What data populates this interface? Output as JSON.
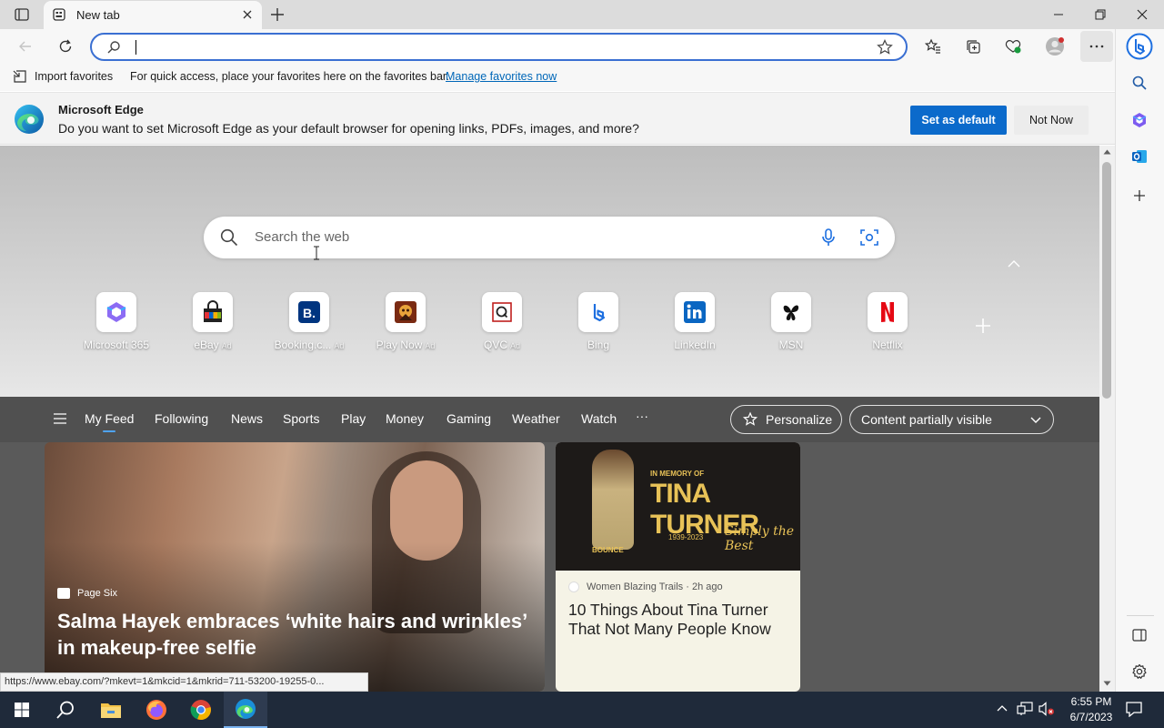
{
  "tab": {
    "title": "New tab"
  },
  "address": {
    "value": ""
  },
  "favorites_bar": {
    "import_label": "Import favorites",
    "tip": "For quick access, place your favorites here on the favorites bar.",
    "manage_link": "Manage favorites now"
  },
  "infobar": {
    "heading": "Microsoft Edge",
    "message": "Do you want to set Microsoft Edge as your default browser for opening links, PDFs, images, and more?",
    "primary": "Set as default",
    "secondary": "Not Now"
  },
  "search": {
    "placeholder": "Search the web"
  },
  "quick_links": [
    {
      "label": "Microsoft 365",
      "ad": ""
    },
    {
      "label": "eBay",
      "ad": "Ad"
    },
    {
      "label": "Booking.c...",
      "ad": "Ad"
    },
    {
      "label": "Play Now",
      "ad": "Ad"
    },
    {
      "label": "QVC",
      "ad": "Ad"
    },
    {
      "label": "Bing",
      "ad": ""
    },
    {
      "label": "LinkedIn",
      "ad": ""
    },
    {
      "label": "MSN",
      "ad": ""
    },
    {
      "label": "Netflix",
      "ad": ""
    }
  ],
  "feed_nav": [
    "My Feed",
    "Following",
    "News",
    "Sports",
    "Play",
    "Money",
    "Gaming",
    "Weather",
    "Watch",
    "···"
  ],
  "feed_controls": {
    "personalize": "Personalize",
    "visibility": "Content partially visible"
  },
  "cards": [
    {
      "source": "Page Six",
      "title": "Salma Hayek embraces ‘white hairs and wrinkles’ in makeup-free selfie"
    },
    {
      "source": "Women Blazing Trails · 2h ago",
      "title": "10 Things About Tina Turner That Not Many People Know",
      "image_text": {
        "memory": "IN MEMORY OF",
        "name": "TINA TURNER",
        "years": "1939-2023",
        "tag": "Simply the Best",
        "brand": "BOUNCE"
      }
    }
  ],
  "status_url": "https://www.ebay.com/?mkevt=1&mkcid=1&mkrid=711-53200-19255-0...",
  "clock": {
    "time": "6:55 PM",
    "date": "6/7/2023"
  },
  "colors": {
    "accent": "#0b6acb",
    "link": "#0067b8",
    "feed_underline": "#4ea4f5"
  }
}
